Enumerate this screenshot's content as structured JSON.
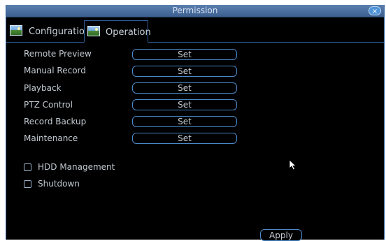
{
  "window": {
    "title": "Permission",
    "close_symbol": "×"
  },
  "tabs": [
    {
      "label": "Configuration",
      "icon": "picture-icon",
      "active": false
    },
    {
      "label": "Operation",
      "icon": "picture-icon",
      "active": true
    }
  ],
  "permissions": [
    {
      "label": "Remote Preview",
      "button": "Set"
    },
    {
      "label": "Manual Record",
      "button": "Set"
    },
    {
      "label": "Playback",
      "button": "Set"
    },
    {
      "label": "PTZ Control",
      "button": "Set"
    },
    {
      "label": "Record Backup",
      "button": "Set"
    },
    {
      "label": "Maintenance",
      "button": "Set"
    }
  ],
  "checkboxes": [
    {
      "label": "HDD Management",
      "checked": false
    },
    {
      "label": "Shutdown",
      "checked": false
    }
  ],
  "apply_label": "Apply",
  "colors": {
    "title_bar": "#4a6f9f",
    "accent_border": "#4a89c9",
    "background": "#000000",
    "text": "#c3cad2"
  }
}
